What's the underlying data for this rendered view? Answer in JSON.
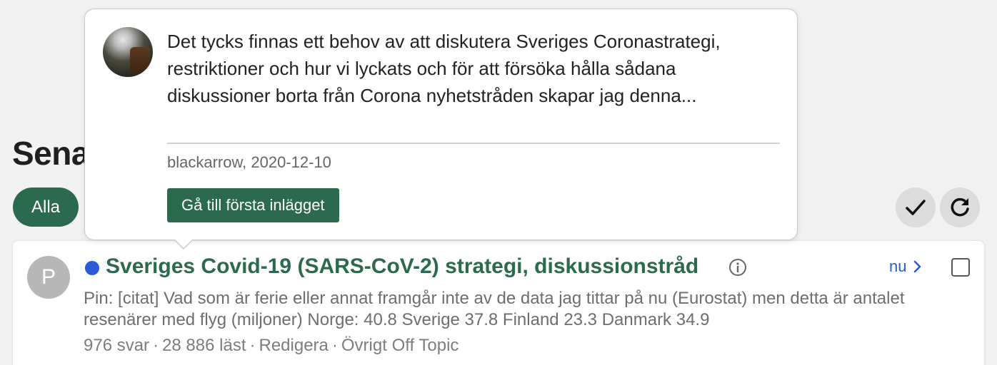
{
  "page": {
    "heading": "Sena"
  },
  "filters": {
    "active_label": "Alla"
  },
  "toolbar": {
    "check_icon": "checkmark-icon",
    "refresh_icon": "refresh-icon"
  },
  "topic": {
    "avatar_letter": "P",
    "unread": true,
    "title": "Sveriges Covid-19 (SARS-CoV-2) strategi, diskussionstråd",
    "time_label": "nu",
    "excerpt": "Pin: [citat] Vad som är ferie eller annat framgår inte av de data jag tittar på nu (Eurostat) men detta är antalet resenärer med flyg (miljoner) Norge: 40.8 Sverige 37.8 Finland 23.3 Danmark 34.9",
    "replies": "976 svar",
    "views": "28 886 läst",
    "edit": "Redigera",
    "category": "Övrigt Off Topic",
    "separator": "·"
  },
  "popover": {
    "text": "Det tycks finnas ett behov av att diskutera Sveriges Coronastrategi, restriktioner och hur vi lyckats och för att försöka hålla sådana diskussioner borta från Corona nyhetstråden skapar jag denna...",
    "author_date": "blackarrow, 2020-12-10",
    "button_label": "Gå till första inlägget"
  },
  "colors": {
    "accent_green": "#2c6a4f",
    "link_blue": "#2a5bd7",
    "unread_dot": "#2a5bd7"
  }
}
